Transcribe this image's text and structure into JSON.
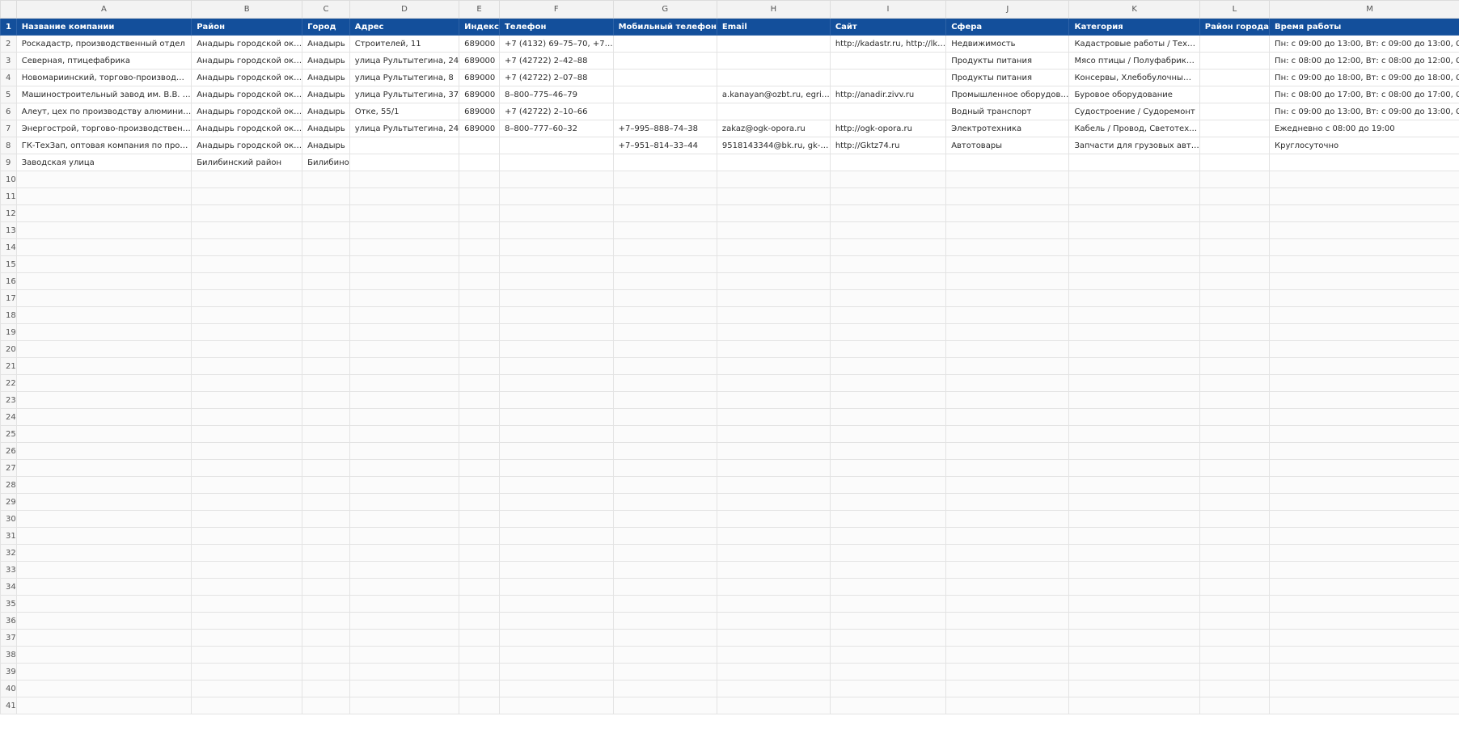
{
  "sheet": {
    "columns": [
      "A",
      "B",
      "C",
      "D",
      "E",
      "F",
      "G",
      "H",
      "I",
      "J",
      "K",
      "L",
      "M"
    ],
    "headers": [
      "Название компании",
      "Район",
      "Город",
      "Адрес",
      "Индекс",
      "Телефон",
      "Мобильный телефон",
      "Email",
      "Сайт",
      "Сфера",
      "Категория",
      "Район города",
      "Время работы"
    ],
    "rows": [
      [
        "Роскадастр, производственный отдел",
        "Анадырь городской ок…",
        "Анадырь",
        "Строителей, 11",
        "689000",
        "+7 (4132) 69–75–70, +7…",
        "",
        "",
        "http://kadastr.ru, http://lk…",
        "Недвижимость",
        "Кадастровые работы / Тех…",
        "",
        "Пн: с 09:00 до 13:00, Вт: с 09:00 до 13:00, С…"
      ],
      [
        "Северная, птицефабрика",
        "Анадырь городской ок…",
        "Анадырь",
        "улица Рультытегина, 24",
        "689000",
        "+7 (42722) 2–42–88",
        "",
        "",
        "",
        "Продукты питания",
        "Мясо птицы / Полуфабрик…",
        "",
        "Пн: с 08:00 до 12:00, Вт: с 08:00 до 12:00, С…"
      ],
      [
        "Новомариинский, торгово-производ…",
        "Анадырь городской ок…",
        "Анадырь",
        "улица Рультытегина, 8",
        "689000",
        "+7 (42722) 2–07–88",
        "",
        "",
        "",
        "Продукты питания",
        "Консервы, Хлебобулочны…",
        "",
        "Пн: с 09:00 до 18:00, Вт: с 09:00 до 18:00, С…"
      ],
      [
        "Машиностроительный завод им. В.В. …",
        "Анадырь городской ок…",
        "Анадырь",
        "улица Рультытегина, 37",
        "689000",
        "8–800–775–46–79",
        "",
        "a.kanayan@ozbt.ru, egri…",
        "http://anadir.zivv.ru",
        "Промышленное оборудов…",
        "Буровое оборудование",
        "",
        "Пн: с 08:00 до 17:00, Вт: с 08:00 до 17:00, С…"
      ],
      [
        "Алеут, цех по производству алюмини…",
        "Анадырь городской ок…",
        "Анадырь",
        "Отке, 55/1",
        "689000",
        "+7 (42722) 2–10–66",
        "",
        "",
        "",
        "Водный транспорт",
        "Судостроение / Судоремонт",
        "",
        "Пн: с 09:00 до 13:00, Вт: с 09:00 до 13:00, С…"
      ],
      [
        "Энергострой, торгово-производствен…",
        "Анадырь городской ок…",
        "Анадырь",
        "улица Рультытегина, 24",
        "689000",
        "8–800–777–60–32",
        "+7–995–888–74–38",
        "zakaz@ogk-opora.ru",
        "http://ogk-opora.ru",
        "Электротехника",
        "Кабель / Провод, Светотех…",
        "",
        "Ежедневно с 08:00 до 19:00"
      ],
      [
        "ГК-ТехЗап, оптовая компания по про…",
        "Анадырь городской ок…",
        "Анадырь",
        "",
        "",
        "",
        "+7–951–814–33–44",
        "9518143344@bk.ru, gk-…",
        "http://Gktz74.ru",
        "Автотовары",
        "Запчасти для грузовых авт…",
        "",
        "Круглосуточно"
      ],
      [
        "Заводская улица",
        "Билибинский район",
        "Билибино",
        "",
        "",
        "",
        "",
        "",
        "",
        "",
        "",
        "",
        ""
      ]
    ],
    "row_numbers": [
      "1",
      "2",
      "3",
      "4",
      "5",
      "6",
      "7",
      "8",
      "9",
      "10",
      "11",
      "12",
      "13",
      "14",
      "15",
      "16",
      "17",
      "18",
      "19",
      "20",
      "21",
      "22",
      "23",
      "24",
      "25",
      "26",
      "27",
      "28",
      "29",
      "30",
      "31",
      "32",
      "33",
      "34",
      "35",
      "36",
      "37",
      "38",
      "39",
      "40",
      "41"
    ],
    "header_color": "#134f9b"
  }
}
